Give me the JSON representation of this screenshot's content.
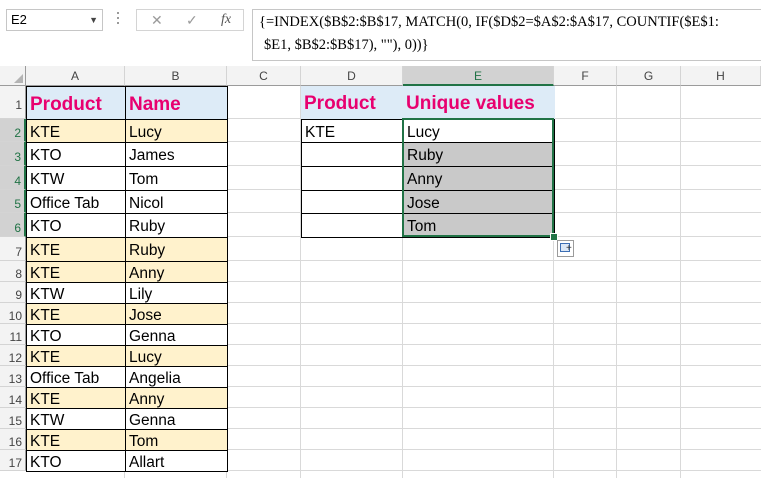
{
  "formula_bar": {
    "name_box": "E2",
    "fx_label": "fx",
    "cancel_glyph": "✕",
    "enter_glyph": "✓",
    "formula_line1": "{=INDEX($B$2:$B$17, MATCH(0, IF($D$2=$A$2:$A$17, COUNTIF($E$1:",
    "formula_line2": "$E1, $B$2:$B$17), \"\"), 0))}"
  },
  "columns": [
    "A",
    "B",
    "C",
    "D",
    "E",
    "F",
    "G",
    "H"
  ],
  "rows": [
    "1",
    "2",
    "3",
    "4",
    "5",
    "6",
    "7",
    "8",
    "9",
    "10",
    "11",
    "12",
    "13",
    "14",
    "15",
    "16",
    "17"
  ],
  "colors": {
    "header_fill": "#ddebf7",
    "header_text": "#e8006f",
    "highlight_fill": "#fff2cc",
    "unique_fill": "#c9c9c9",
    "selection": "#217346"
  },
  "table1": {
    "header": [
      "Product",
      "Name"
    ],
    "rows": [
      [
        "KTE",
        "Lucy"
      ],
      [
        "KTO",
        "James"
      ],
      [
        "KTW",
        "Tom"
      ],
      [
        "Office Tab",
        "Nicol"
      ],
      [
        "KTO",
        "Ruby"
      ],
      [
        "KTE",
        "Ruby"
      ],
      [
        "KTE",
        "Anny"
      ],
      [
        "KTW",
        "Lily"
      ],
      [
        "KTE",
        "Jose"
      ],
      [
        "KTO",
        "Genna"
      ],
      [
        "KTE",
        "Lucy"
      ],
      [
        "Office Tab",
        "Angelia"
      ],
      [
        "KTE",
        "Anny"
      ],
      [
        "KTW",
        "Genna"
      ],
      [
        "KTE",
        "Tom"
      ],
      [
        "KTO",
        "Allart"
      ]
    ]
  },
  "table2": {
    "header": [
      "Product",
      "Unique values"
    ],
    "product_value": "KTE",
    "unique_values": [
      "Lucy",
      "Ruby",
      "Anny",
      "Jose",
      "Tom"
    ]
  }
}
